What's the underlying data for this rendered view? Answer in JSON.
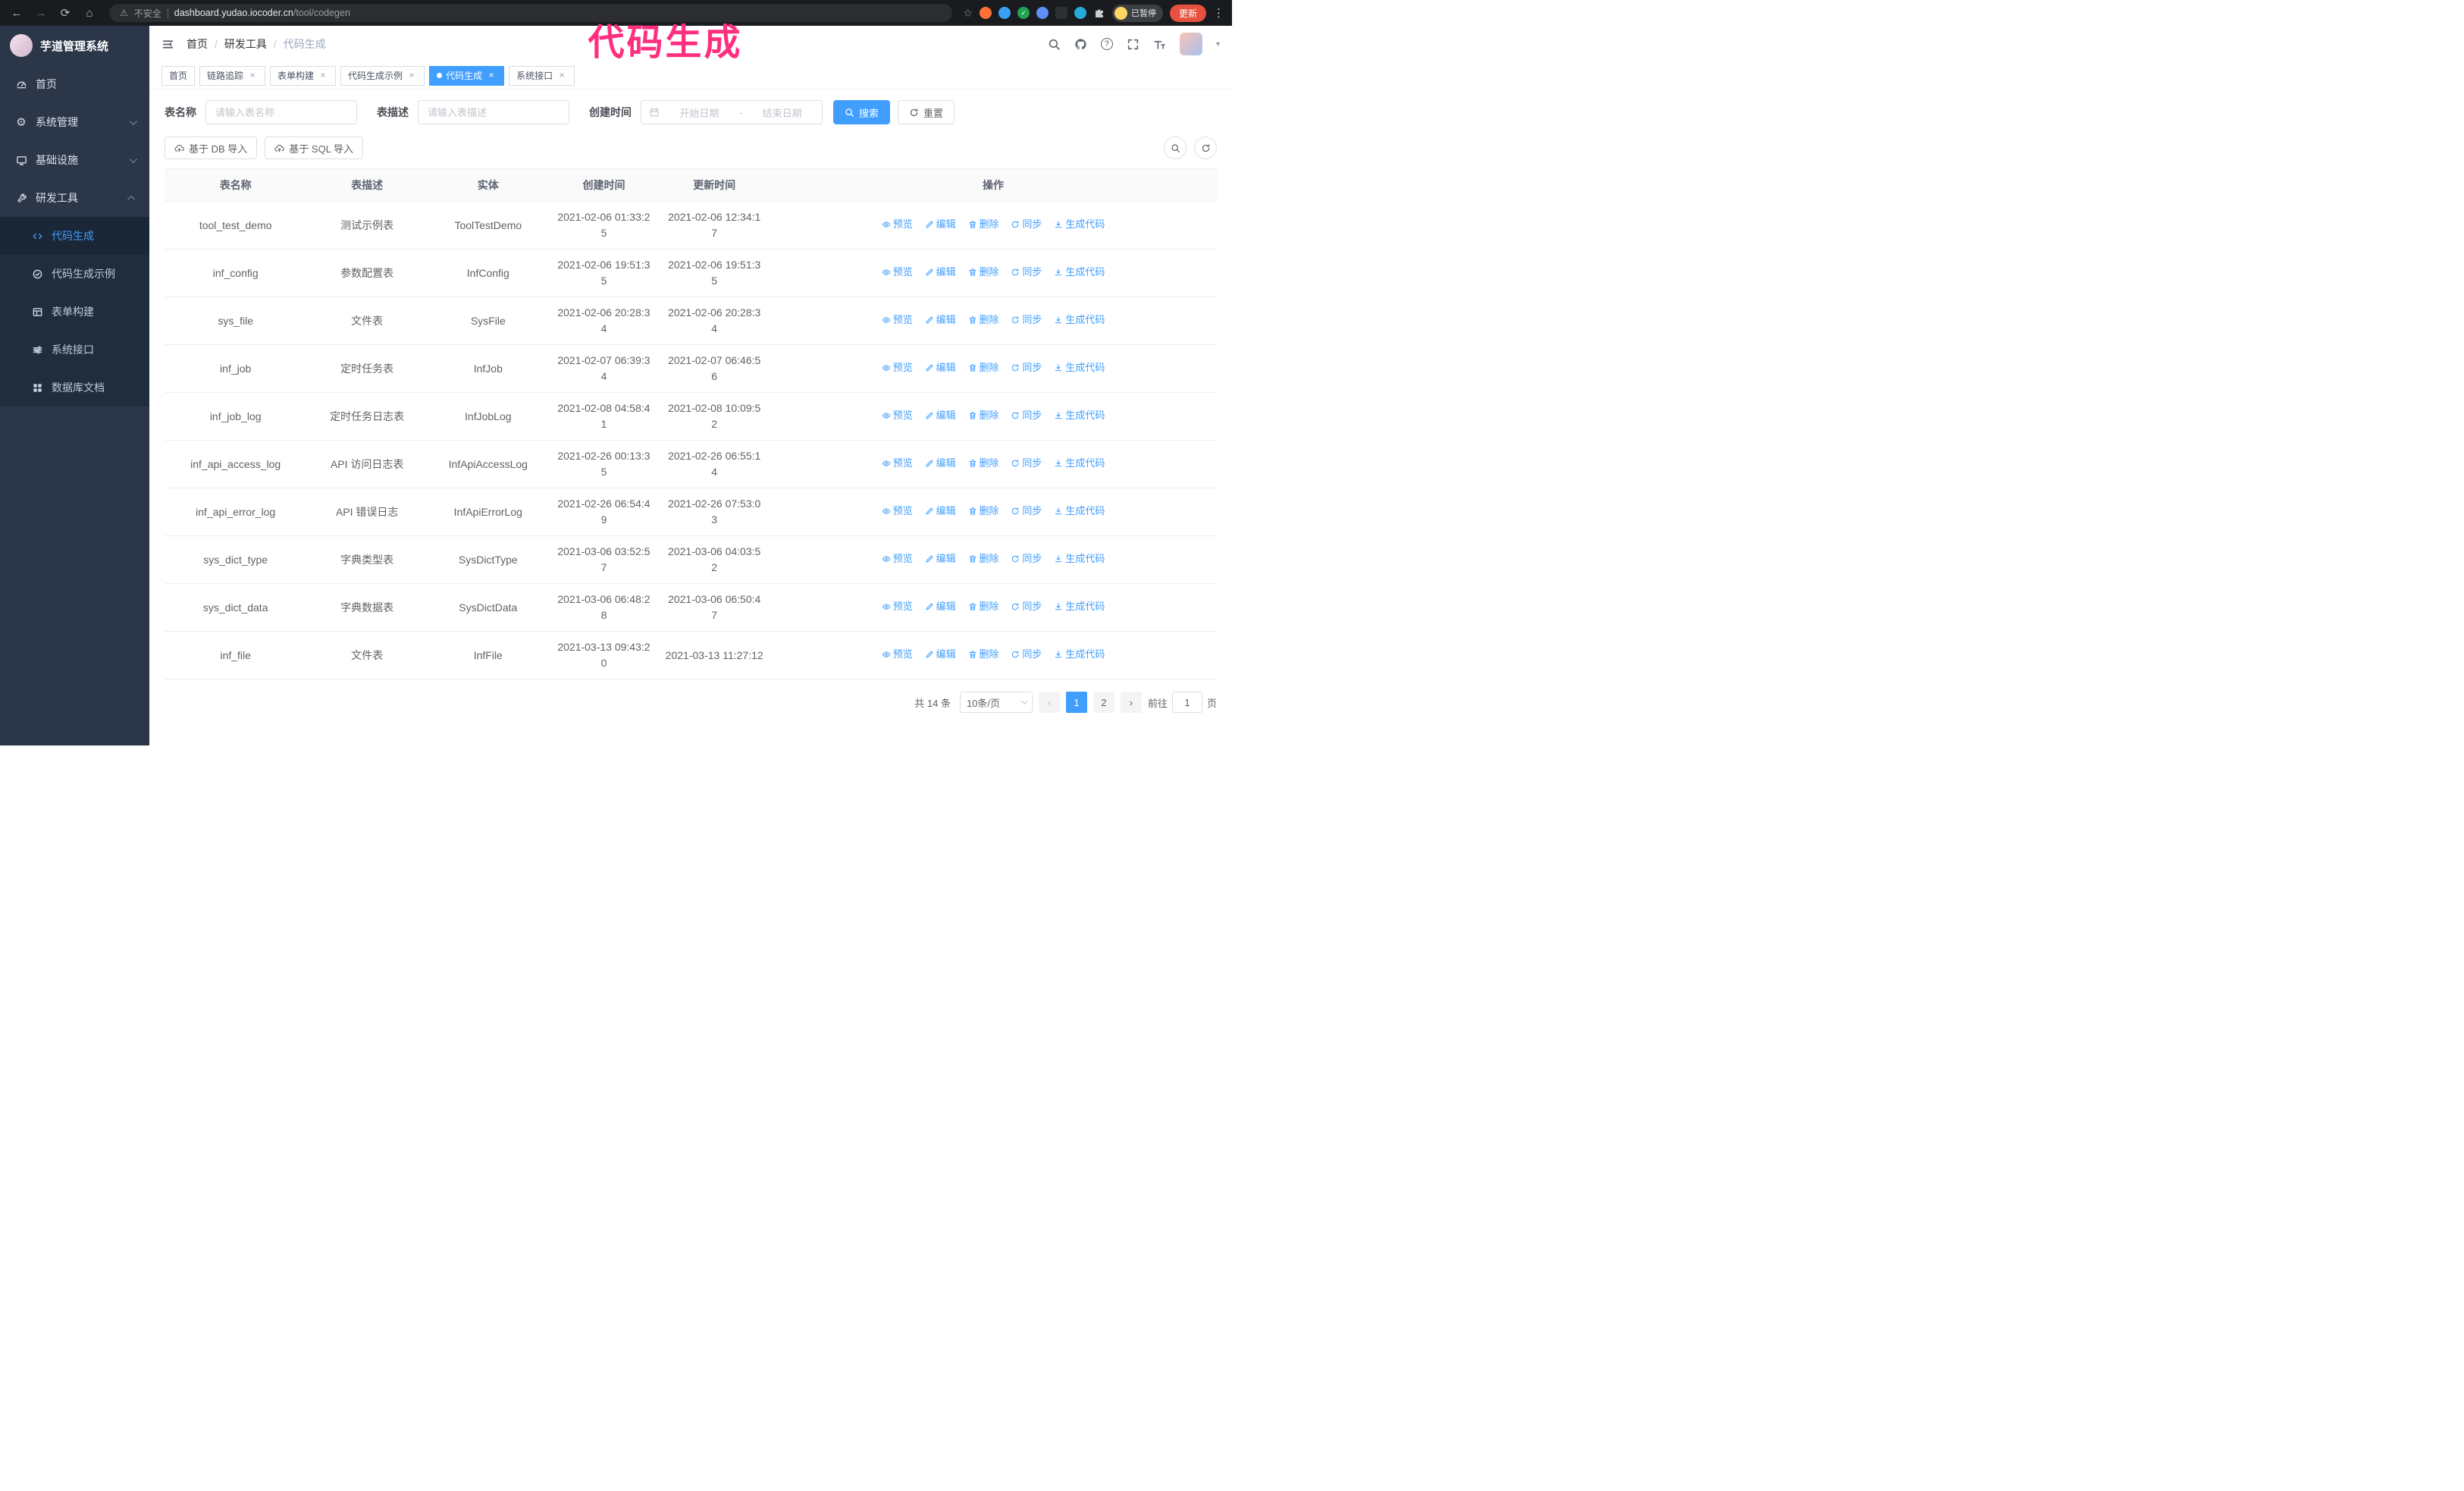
{
  "theme": {
    "accent": "#409eff",
    "sidebar_bg": "#2b3648",
    "annotation_color": "#ff2f80"
  },
  "annotation": {
    "text": "代码生成"
  },
  "browser": {
    "security_label": "不安全",
    "url_host": "dashboard.yudao.iocoder.cn",
    "url_path": "/tool/codegen",
    "paused_badge": "已暂停",
    "update_button": "更新"
  },
  "icons": {
    "back": "←",
    "forward": "→",
    "reload": "⟳",
    "home": "⌂",
    "warning": "⚠",
    "star": "☆",
    "menu_dots": "⋮",
    "caret_down": "▾",
    "question_mark": "?",
    "close": "×",
    "check": "✓",
    "gear": "⚙"
  },
  "sidebar": {
    "app_title": "芋道管理系统",
    "items": [
      {
        "label": "首页"
      },
      {
        "label": "系统管理"
      },
      {
        "label": "基础设施"
      },
      {
        "label": "研发工具"
      }
    ],
    "subitems": [
      {
        "label": "代码生成"
      },
      {
        "label": "代码生成示例"
      },
      {
        "label": "表单构建"
      },
      {
        "label": "系统接口"
      },
      {
        "label": "数据库文档"
      }
    ]
  },
  "header": {
    "breadcrumb": [
      "首页",
      "研发工具",
      "代码生成"
    ]
  },
  "tabs": [
    {
      "label": "首页"
    },
    {
      "label": "链路追踪"
    },
    {
      "label": "表单构建"
    },
    {
      "label": "代码生成示例"
    },
    {
      "label": "代码生成"
    },
    {
      "label": "系统接口"
    }
  ],
  "filters": {
    "table_name_label": "表名称",
    "table_name_placeholder": "请输入表名称",
    "table_desc_label": "表描述",
    "table_desc_placeholder": "请输入表描述",
    "create_time_label": "创建时间",
    "start_date_placeholder": "开始日期",
    "end_date_placeholder": "结束日期",
    "range_separator": "-",
    "search_button": "搜索",
    "reset_button": "重置"
  },
  "toolbar": {
    "import_db_button": "基于 DB 导入",
    "import_sql_button": "基于 SQL 导入"
  },
  "table": {
    "columns": [
      "表名称",
      "表描述",
      "实体",
      "创建时间",
      "更新时间",
      "操作"
    ],
    "actions": [
      "预览",
      "编辑",
      "删除",
      "同步",
      "生成代码"
    ],
    "rows": [
      {
        "name": "tool_test_demo",
        "desc": "测试示例表",
        "entity": "ToolTestDemo",
        "created": "2021-02-06 01:33:25",
        "updated": "2021-02-06 12:34:17"
      },
      {
        "name": "inf_config",
        "desc": "参数配置表",
        "entity": "InfConfig",
        "created": "2021-02-06 19:51:35",
        "updated": "2021-02-06 19:51:35"
      },
      {
        "name": "sys_file",
        "desc": "文件表",
        "entity": "SysFile",
        "created": "2021-02-06 20:28:34",
        "updated": "2021-02-06 20:28:34"
      },
      {
        "name": "inf_job",
        "desc": "定时任务表",
        "entity": "InfJob",
        "created": "2021-02-07 06:39:34",
        "updated": "2021-02-07 06:46:56"
      },
      {
        "name": "inf_job_log",
        "desc": "定时任务日志表",
        "entity": "InfJobLog",
        "created": "2021-02-08 04:58:41",
        "updated": "2021-02-08 10:09:52"
      },
      {
        "name": "inf_api_access_log",
        "desc": "API 访问日志表",
        "entity": "InfApiAccessLog",
        "created": "2021-02-26 00:13:35",
        "updated": "2021-02-26 06:55:14"
      },
      {
        "name": "inf_api_error_log",
        "desc": "API 错误日志",
        "entity": "InfApiErrorLog",
        "created": "2021-02-26 06:54:49",
        "updated": "2021-02-26 07:53:03"
      },
      {
        "name": "sys_dict_type",
        "desc": "字典类型表",
        "entity": "SysDictType",
        "created": "2021-03-06 03:52:57",
        "updated": "2021-03-06 04:03:52"
      },
      {
        "name": "sys_dict_data",
        "desc": "字典数据表",
        "entity": "SysDictData",
        "created": "2021-03-06 06:48:28",
        "updated": "2021-03-06 06:50:47"
      },
      {
        "name": "inf_file",
        "desc": "文件表",
        "entity": "InfFile",
        "created": "2021-03-13 09:43:20",
        "updated": "2021-03-13 11:27:12"
      }
    ]
  },
  "pagination": {
    "total": "共 14 条",
    "page_size": "10条/页",
    "prev": "‹",
    "next": "›",
    "pages": [
      "1",
      "2"
    ],
    "current_page": "1",
    "goto_label": "前往",
    "goto_value": "1",
    "page_unit": "页"
  }
}
